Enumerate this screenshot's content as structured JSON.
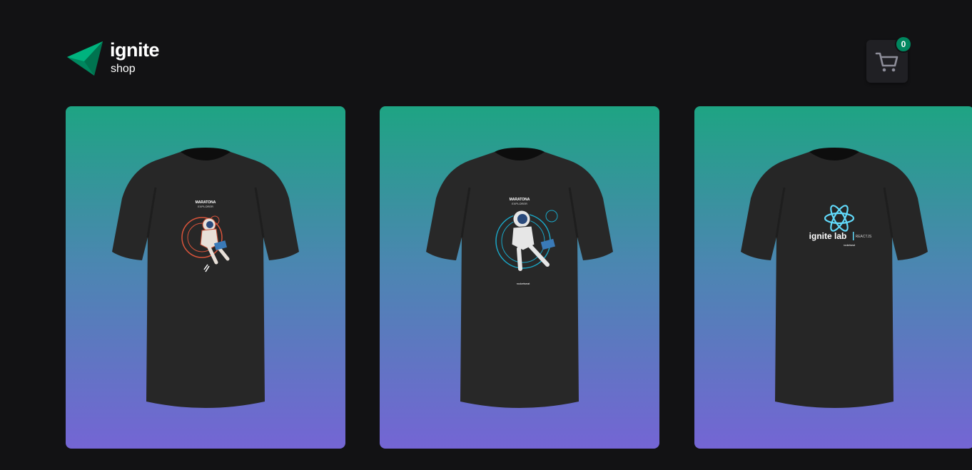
{
  "header": {
    "logo": {
      "title": "ignite",
      "subtitle": "shop",
      "icon": "ignite-logo-icon"
    },
    "cart": {
      "icon": "shopping-cart-icon",
      "count": "0"
    }
  },
  "products": [
    {
      "design": "marathon-explorer-astronaut-red"
    },
    {
      "design": "marathon-explorer-astronaut-blue"
    },
    {
      "design": "ignite-lab-reactjs"
    }
  ],
  "colors": {
    "background": "#121214",
    "card_gradient_top": "#1ea483",
    "card_gradient_bottom": "#7465d4",
    "badge": "#00875f",
    "cart_button": "#202024"
  },
  "shirt_prints": {
    "astronaut_title": "MARATONA",
    "astronaut_sub": "EXPLORER",
    "brand": "rocketseat",
    "lab_title": "ignite lab",
    "lab_tag": "REACTJS"
  }
}
